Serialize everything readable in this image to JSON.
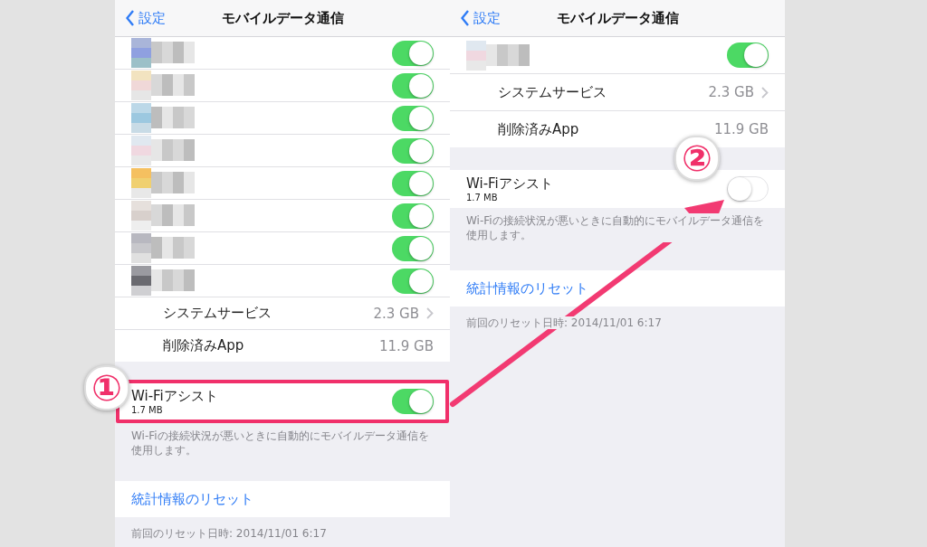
{
  "screens": [
    {
      "nav": {
        "back": "設定",
        "title": "モバイルデータ通信"
      },
      "rows": [
        {
          "kind": "app",
          "on": true
        },
        {
          "kind": "app",
          "on": true
        },
        {
          "kind": "app",
          "on": true
        },
        {
          "kind": "app",
          "on": true
        },
        {
          "kind": "app",
          "on": true
        },
        {
          "kind": "app",
          "on": true
        },
        {
          "kind": "app",
          "on": true
        },
        {
          "kind": "app",
          "on": true
        },
        {
          "kind": "detail",
          "label": "システムサービス",
          "value": "2.3 GB"
        },
        {
          "kind": "plain",
          "label": "削除済みApp",
          "value": "11.9 GB"
        }
      ],
      "wifi_assist": {
        "label": "Wi-Fiアシスト",
        "usage": "1.7 MB",
        "on": true,
        "highlighted": true
      },
      "footnote": "Wi-Fiの接続状況が悪いときに自動的にモバイルデータ通信を使用します。",
      "reset_button": "統計情報のリセット",
      "last_reset": "前回のリセット日時: 2014/11/01 6:17"
    },
    {
      "nav": {
        "back": "設定",
        "title": "モバイルデータ通信"
      },
      "rows": [
        {
          "kind": "app",
          "on": true
        },
        {
          "kind": "detail",
          "label": "システムサービス",
          "value": "2.3 GB"
        },
        {
          "kind": "plain",
          "label": "削除済みApp",
          "value": "11.9 GB"
        }
      ],
      "wifi_assist": {
        "label": "Wi-Fiアシスト",
        "usage": "1.7 MB",
        "on": false,
        "highlighted": false
      },
      "footnote": "Wi-Fiの接続状況が悪いときに自動的にモバイルデータ通信を使用します。",
      "reset_button": "統計情報のリセット",
      "last_reset": "前回のリセット日時: 2014/11/01 6:17"
    }
  ],
  "annotations": [
    {
      "badge": "①"
    },
    {
      "badge": "②"
    }
  ]
}
